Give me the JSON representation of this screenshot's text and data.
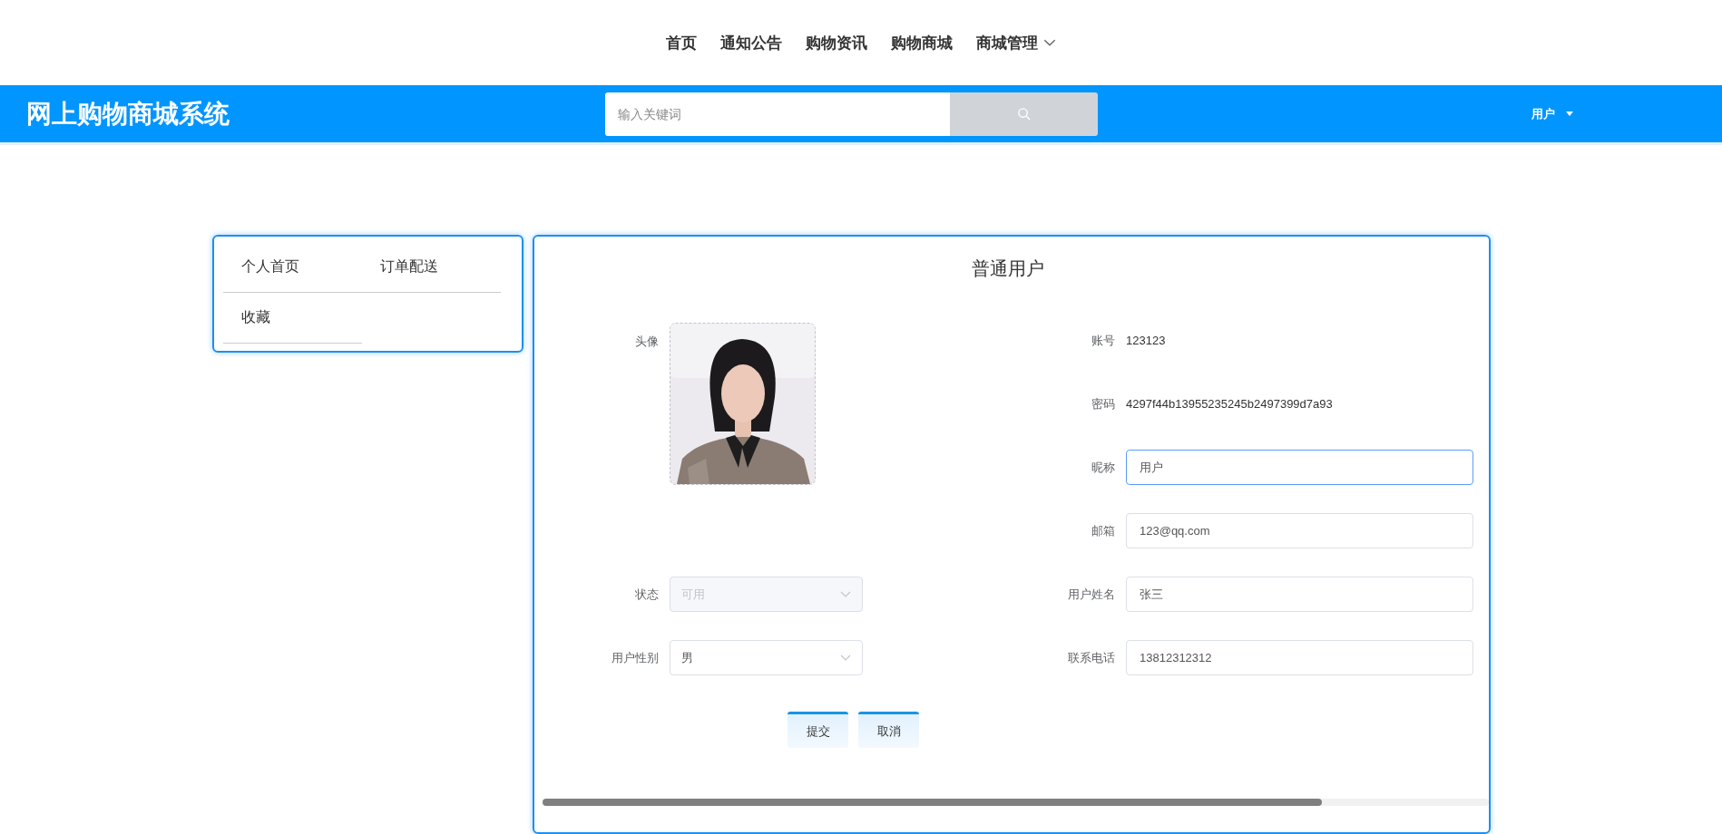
{
  "top_nav": [
    {
      "label": "首页",
      "dropdown": false
    },
    {
      "label": "通知公告",
      "dropdown": false
    },
    {
      "label": "购物资讯",
      "dropdown": false
    },
    {
      "label": "购物商城",
      "dropdown": false
    },
    {
      "label": "商城管理",
      "dropdown": true
    }
  ],
  "header": {
    "title": "网上购物商城系统",
    "search": {
      "placeholder": "输入关键词"
    },
    "user_menu": {
      "label": "用户"
    }
  },
  "sidebar": {
    "items": [
      {
        "label": "个人首页"
      },
      {
        "label": "订单配送"
      },
      {
        "label": "收藏"
      }
    ]
  },
  "profile": {
    "title": "普通用户",
    "fields": [
      {
        "label": "头像"
      },
      {
        "kind": "text",
        "label": "账号",
        "value": "123123"
      },
      {
        "kind": "text",
        "label": "密码",
        "value": "4297f44b13955235245b2497399d7a93"
      },
      {
        "kind": "input",
        "label": "昵称",
        "value": "用户",
        "focused": true
      },
      {
        "kind": "input",
        "label": "邮箱",
        "value": "123@qq.com",
        "focused": false
      },
      {
        "kind": "select",
        "label": "状态",
        "value": "可用",
        "disabled": true
      },
      {
        "kind": "input",
        "label": "用户姓名",
        "value": "张三",
        "focused": false
      },
      {
        "kind": "select",
        "label": "用户性别",
        "value": "男",
        "disabled": false
      },
      {
        "kind": "input",
        "label": "联系电话",
        "value": "13812312312",
        "focused": false
      }
    ],
    "buttons": [
      {
        "label": "提交"
      },
      {
        "label": "取消"
      }
    ]
  }
}
